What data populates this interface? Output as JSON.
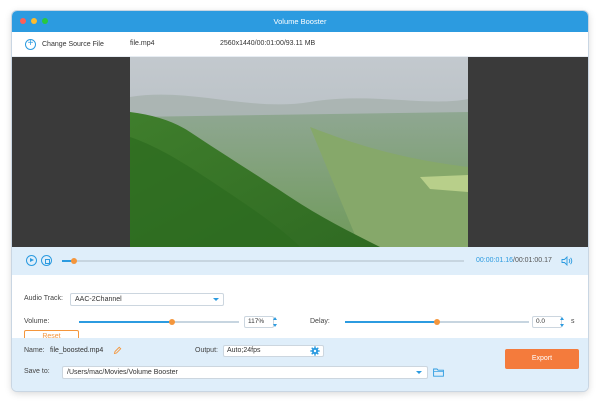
{
  "window": {
    "title": "Volume Booster"
  },
  "toolbar": {
    "add_label": "Change Source File",
    "file_name": "file.mp4",
    "file_meta": "2560x1440/00:01:00/93.11 MB"
  },
  "player": {
    "progress_fraction": 0.03,
    "time_current": "00:00:01.16",
    "time_separator": "/",
    "time_total": "00:01:00.17"
  },
  "audio": {
    "track_label": "Audio Track:",
    "track_value": "AAC-2Channel",
    "volume_label": "Volume:",
    "volume_value": "117%",
    "volume_fraction": 0.58,
    "delay_label": "Delay:",
    "delay_value": "0.0",
    "delay_unit": "s",
    "delay_fraction": 0.5,
    "reset_label": "Reset"
  },
  "output": {
    "name_label": "Name:",
    "name_value": "file_boosted.mp4",
    "output_label": "Output:",
    "output_value": "Auto;24fps",
    "save_label": "Save to:",
    "save_path": "/Users/mac/Movies/Volume Booster",
    "export_label": "Export"
  },
  "colors": {
    "accent": "#2c9be0",
    "knob": "#f4963c",
    "export": "#f47b3c",
    "panel": "#dfeefa"
  },
  "icons": [
    "add-circle-icon",
    "play-icon",
    "stop-icon",
    "speaker-icon",
    "edit-icon",
    "gear-icon",
    "folder-icon",
    "chevron-down-icon"
  ]
}
